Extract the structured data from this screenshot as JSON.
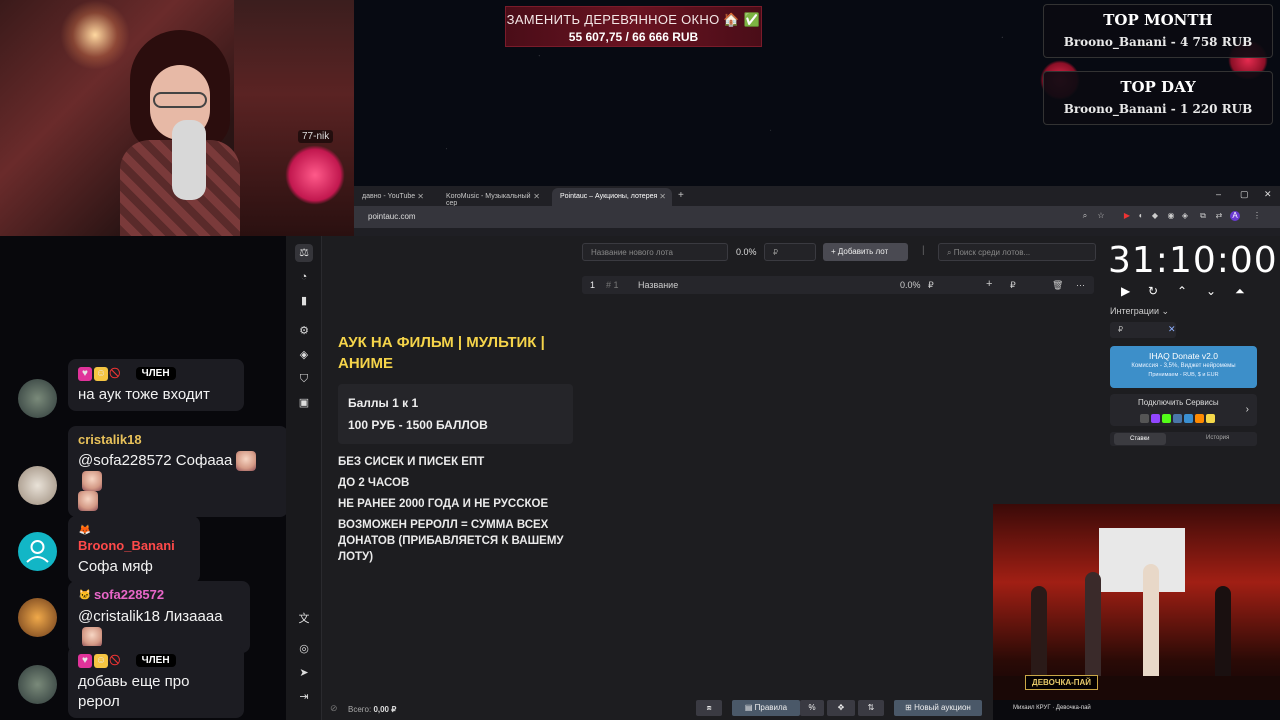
{
  "goal": {
    "title": "ЗАМЕНИТЬ ДЕРЕВЯННОЕ ОКНО 🏠 ✅",
    "amount": "55 607,75 / 66 666 RUB"
  },
  "top_month": {
    "heading": "TOP MONTH",
    "value": "Broono_Banani - 4 758 RUB"
  },
  "top_day": {
    "heading": "TOP DAY",
    "value": "Broono_Banani - 1 220 RUB"
  },
  "webcam": {
    "tag": "77-nik"
  },
  "chat": {
    "messages": [
      {
        "name": "",
        "badge": "ЧЛЕН",
        "text": "на аук тоже входит",
        "name_color": "#1a1aff"
      },
      {
        "name": "cristalik18",
        "text": "@sofa228572 Софааа",
        "name_color": "#e8c15a"
      },
      {
        "name": "Broono_Banani",
        "text": "Софа мяф",
        "name_color": "#ff4a4a"
      },
      {
        "name": "sofa228572",
        "text": "@cristalik18 Лизаааа",
        "name_color": "#e866c8"
      },
      {
        "name": "",
        "badge": "ЧЛЕН",
        "text": "добавь еще про рерол",
        "name_color": "#1a1aff"
      }
    ]
  },
  "browser": {
    "tabs": [
      {
        "label": "давно - YouTube"
      },
      {
        "label": "KoroMusic - Музыкальный сер"
      },
      {
        "label": "Pointauc – Аукционы, лотерея"
      }
    ],
    "url": "pointauc.com",
    "window_controls": [
      "–",
      "▢",
      "✕"
    ]
  },
  "app": {
    "rules_title": "АУК НА ФИЛЬМ | МУЛЬТИК | АНИМЕ",
    "card": {
      "line1": "Баллы 1 к 1",
      "line2": "100 РУБ - 1500 БАЛЛОВ"
    },
    "rules": [
      "БЕЗ СИСЕК И ПИСЕК ЕПТ",
      "ДО 2 ЧАСОВ",
      "НЕ РАНЕЕ 2000 ГОДА И НЕ РУССКОЕ",
      "ВОЗМОЖЕН РЕРОЛЛ = СУММА ВСЕХ ДОНАТОВ (ПРИБАВЛЯЕТСЯ К ВАШЕМУ ЛОТУ)"
    ],
    "new_lot_placeholder": "Название нового лота",
    "percent": "0.0%",
    "amount_placeholder": "₽",
    "add_lot": "Добавить лот",
    "search_placeholder": "Поиск среди лотов...",
    "lot": {
      "index": "1",
      "id": "# 1",
      "name": "Название",
      "percent": "0.0%",
      "currency": "₽"
    },
    "timer": "31:10:00",
    "integrations": "Интеграции",
    "rub_field": "₽",
    "donate": {
      "title": "IHAQ Donate v2.0",
      "subtitle": "Комиссия - 3,5%, Виджет нейромемы",
      "footer": "Принимаем - RUB, $ и EUR"
    },
    "services": "Подключить Сервисы",
    "tabs": {
      "bets": "Ставки",
      "history": "История"
    },
    "total_label": "Всего:",
    "total_value": "0,00 ₽",
    "rules_btn": "Правила",
    "new_auction": "Новый аукцион"
  },
  "video": {
    "caption": "ДЕВОЧКА-ПАЙ",
    "now_playing": "Михаил КРУГ · Девочка-пай"
  },
  "colors": {
    "accent_yellow": "#f5d44a",
    "donate_blue": "#3d8fc9",
    "goal_red": "#6a1321"
  }
}
